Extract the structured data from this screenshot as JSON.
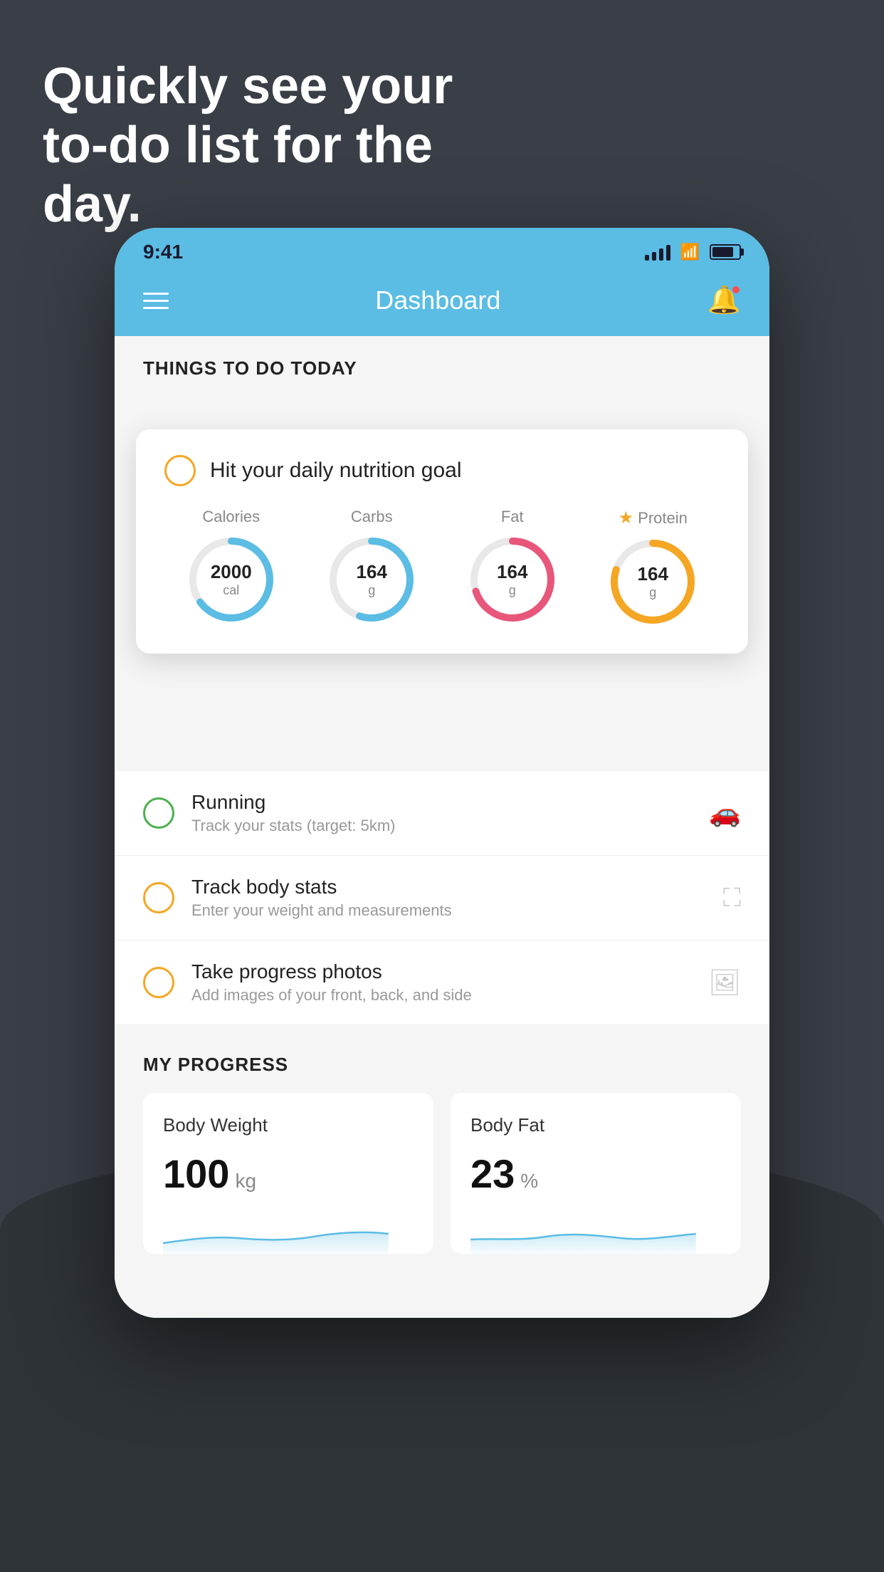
{
  "hero": {
    "title": "Quickly see your to-do list for the day."
  },
  "status_bar": {
    "time": "9:41"
  },
  "header": {
    "title": "Dashboard"
  },
  "things_to_do": {
    "section_title": "THINGS TO DO TODAY"
  },
  "nutrition_card": {
    "title": "Hit your daily nutrition goal",
    "nutrients": [
      {
        "label": "Calories",
        "value": "2000",
        "unit": "cal",
        "color": "#5bbce4",
        "track_color": "#e8e8e8",
        "percent": 65
      },
      {
        "label": "Carbs",
        "value": "164",
        "unit": "g",
        "color": "#5bbce4",
        "track_color": "#e8e8e8",
        "percent": 55
      },
      {
        "label": "Fat",
        "value": "164",
        "unit": "g",
        "color": "#e8567a",
        "track_color": "#e8e8e8",
        "percent": 70
      },
      {
        "label": "Protein",
        "value": "164",
        "unit": "g",
        "color": "#f5a623",
        "track_color": "#e8e8e8",
        "percent": 80,
        "starred": true
      }
    ]
  },
  "todo_items": [
    {
      "label": "Running",
      "sub": "Track your stats (target: 5km)",
      "circle_color": "green",
      "icon": "👟"
    },
    {
      "label": "Track body stats",
      "sub": "Enter your weight and measurements",
      "circle_color": "yellow",
      "icon": "⚖"
    },
    {
      "label": "Take progress photos",
      "sub": "Add images of your front, back, and side",
      "circle_color": "yellow",
      "icon": "🖼"
    }
  ],
  "progress": {
    "section_title": "MY PROGRESS",
    "cards": [
      {
        "title": "Body Weight",
        "value": "100",
        "unit": "kg"
      },
      {
        "title": "Body Fat",
        "value": "23",
        "unit": "%"
      }
    ]
  }
}
